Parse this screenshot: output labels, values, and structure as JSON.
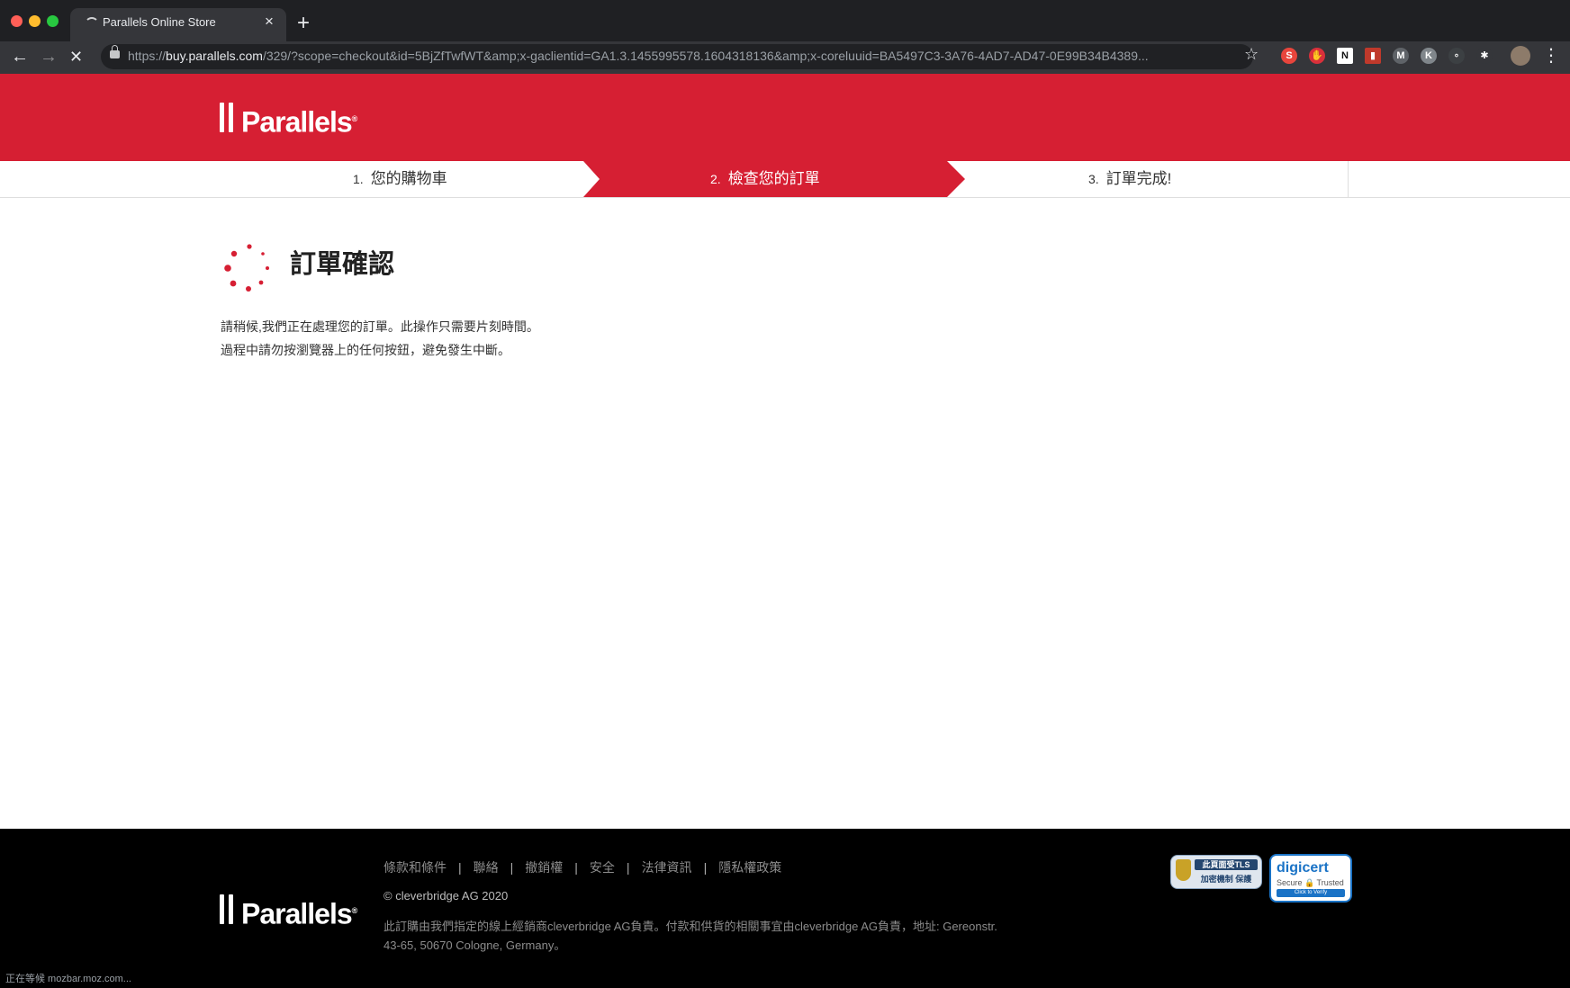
{
  "browser": {
    "tab_title": "Parallels Online Store",
    "tab_close": "×",
    "new_tab": "+",
    "url_scheme": "https://",
    "url_host": "buy.parallels.com",
    "url_rest": "/329/?scope=checkout&id=5BjZfTwfWT&amp;x-gaclientid=GA1.3.1455995578.1604318136&amp;x-coreluuid=BA5497C3-3A76-4AD7-AD47-0E99B34B4389...",
    "back": "←",
    "forward": "→",
    "stop": "✕",
    "bookmark": "☆",
    "menu": "⋮",
    "extensions": [
      {
        "label": "S",
        "color": "#e8453c"
      },
      {
        "label": "✋",
        "color": "#d9303b"
      },
      {
        "label": "N",
        "color": "#ffffff"
      },
      {
        "label": "▮",
        "color": "#c0392b"
      },
      {
        "label": "M",
        "color": "#5f6368"
      },
      {
        "label": "K",
        "color": "#80868b"
      },
      {
        "label": "∘",
        "color": "#3c4043"
      },
      {
        "label": "✱",
        "color": "#35363a"
      }
    ],
    "status": "正在等候 mozbar.moz.com..."
  },
  "brand": {
    "name": "Parallels",
    "reg": "®",
    "color": "#d61f33"
  },
  "steps": [
    {
      "num": "1.",
      "label": "您的購物車"
    },
    {
      "num": "2.",
      "label": "檢查您的訂單"
    },
    {
      "num": "3.",
      "label": "訂單完成!"
    }
  ],
  "main": {
    "title": "訂單確認",
    "line1": "請稍候,我們正在處理您的訂單。此操作只需要片刻時間。",
    "line2": "過程中請勿按瀏覽器上的任何按鈕，避免發生中斷。"
  },
  "footer": {
    "links": [
      "條款和條件",
      "聯絡",
      "撤銷權",
      "安全",
      "法律資訊",
      "隱私權政策"
    ],
    "sep": "|",
    "copyright": "© cleverbridge AG 2020",
    "disclaimer": "此訂購由我們指定的線上經銷商cleverbridge AG負責。付款和供貨的相關事宜由cleverbridge AG負責，地址: Gereonstr. 43-65, 50670 Cologne, Germany。",
    "tls_badge_line1": "此頁面受TLS",
    "tls_badge_line2": "加密機制 保護",
    "digicert_logo": "digicert",
    "digicert_sub": "Secure 🔒 Trusted",
    "digicert_cta": "Click to Verify"
  }
}
